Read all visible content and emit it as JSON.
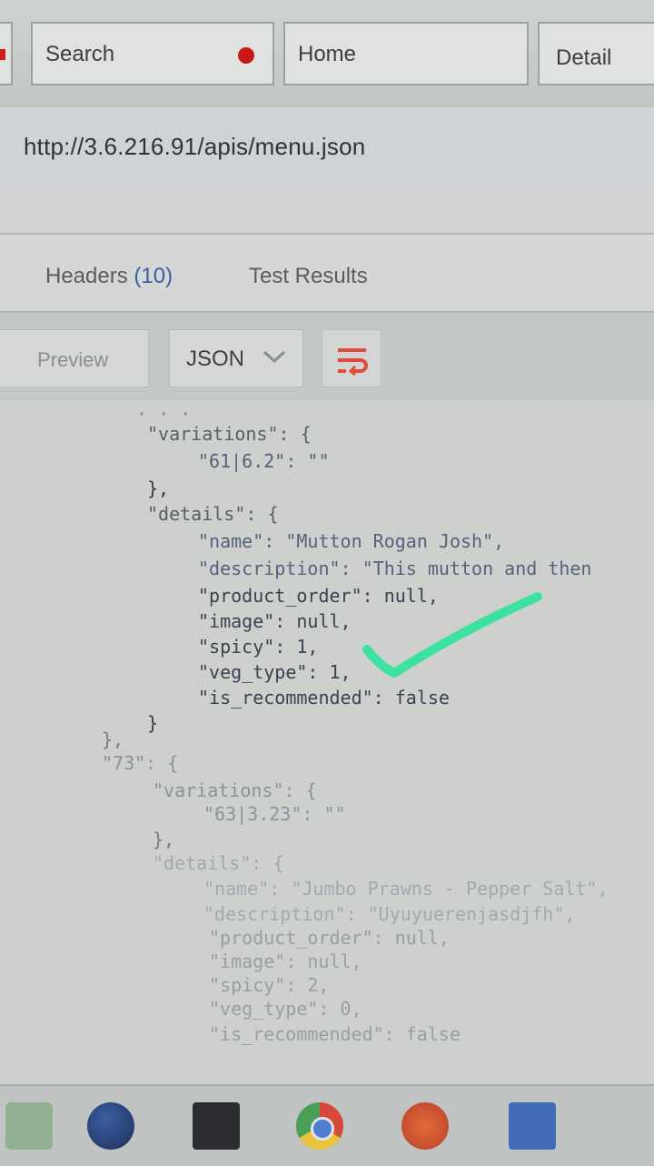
{
  "tabs": {
    "search": "Search",
    "home": "Home",
    "detail": "Detail"
  },
  "url": "http://3.6.216.91/apis/menu.json",
  "response_tabs": {
    "headers_label": "Headers",
    "headers_count": "(10)",
    "tests_label": "Test Results"
  },
  "toolbar": {
    "preview": "Preview",
    "format": "JSON"
  },
  "code_lines": {
    "l1": "\"variations\": {",
    "l2": "\"61|6.2\": \"\"",
    "l3": "},",
    "l4": "\"details\": {",
    "l5": "\"name\": \"Mutton Rogan Josh\",",
    "l6": "\"description\": \"This mutton and then",
    "l7": "\"product_order\": null,",
    "l8": "\"image\": null,",
    "l9": "\"spicy\": 1,",
    "l10": "\"veg_type\": 1,",
    "l11": "\"is_recommended\": false",
    "l12": "}",
    "l13": "},",
    "l14": "\"73\": {",
    "l15": "\"variations\": {",
    "l16": "\"63|3.23\": \"\"",
    "l17": "},",
    "l18": "\"details\": {",
    "l19": "\"name\": \"Jumbo Prawns - Pepper Salt\",",
    "l20": "\"description\": \"Uyuyuerenjasdjfh\",",
    "l21": "\"product_order\": null,",
    "l22": "\"image\": null,",
    "l23": "\"spicy\": 2,",
    "l24": "\"veg_type\": 0,",
    "l25": "\"is_recommended\": false"
  },
  "colors": {
    "checkmark": "#3de2a0",
    "record_dot": "#c91818",
    "wrap_icon": "#e04a3a",
    "count": "#3a5f9d"
  },
  "icons": {
    "tab_dot": "record-dot-icon",
    "format_dropdown": "chevron-down-icon",
    "wrap": "word-wrap-icon",
    "annotation": "checkmark-icon"
  }
}
